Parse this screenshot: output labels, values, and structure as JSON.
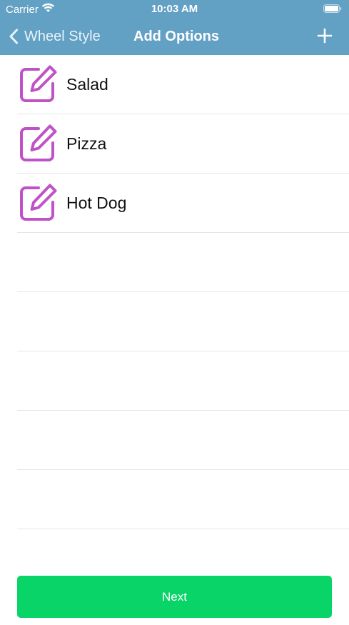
{
  "status_bar": {
    "carrier": "Carrier",
    "time": "10:03 AM"
  },
  "nav": {
    "back_label": "Wheel Style",
    "title": "Add Options"
  },
  "options": [
    {
      "label": "Salad"
    },
    {
      "label": "Pizza"
    },
    {
      "label": "Hot Dog"
    },
    {
      "label": ""
    },
    {
      "label": ""
    },
    {
      "label": ""
    },
    {
      "label": ""
    },
    {
      "label": ""
    }
  ],
  "next_button": {
    "label": "Next"
  },
  "colors": {
    "header_bg": "#62a0c4",
    "edit_icon": "#c052c7",
    "next_button_bg": "#09d467"
  },
  "icons": {
    "back": "chevron-left-icon",
    "add": "plus-icon",
    "edit": "edit-icon",
    "wifi": "wifi-icon",
    "battery": "battery-icon"
  }
}
